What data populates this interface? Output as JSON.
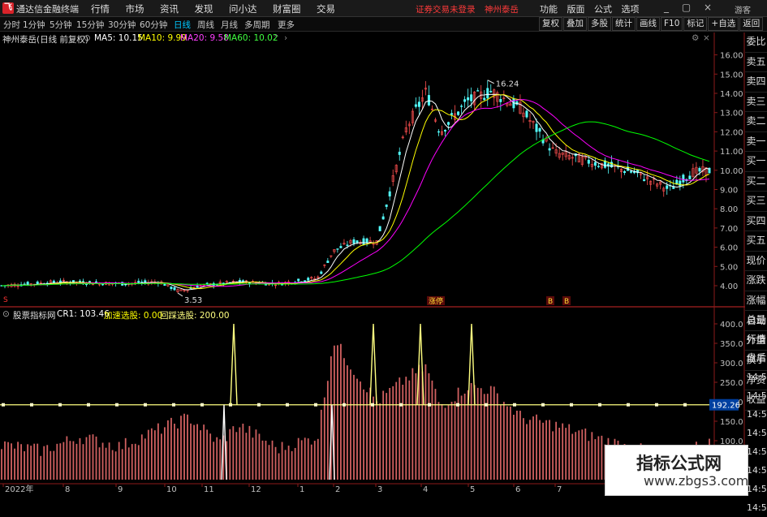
{
  "app": {
    "title": "通达信金融终端"
  },
  "menu": [
    "行情",
    "市场",
    "资讯",
    "发现",
    "问小达",
    "财富圈",
    "交易"
  ],
  "notice": {
    "line1": "证券交易未登录",
    "line2": "神州泰岳"
  },
  "right_menu": [
    "功能",
    "版面",
    "公式",
    "选项"
  ],
  "window_controls": "_ ▢ ×",
  "guest_label": "游客",
  "periods": [
    "分时",
    "1分钟",
    "5分钟",
    "15分钟",
    "30分钟",
    "60分钟",
    "日线",
    "周线",
    "月线",
    "多周期",
    "更多"
  ],
  "active_period": "日线",
  "right_tools": [
    "复权",
    "叠加",
    "多股",
    "统计",
    "画线",
    "F10",
    "标记",
    "+自选",
    "返回"
  ],
  "price_header": {
    "name": "神州泰岳(日线 前复权)",
    "ma5": "MA5: 10.15",
    "ma10": "MA10: 9.99",
    "ma20": "MA20: 9.58",
    "ma60": "MA60: 10.02"
  },
  "indicator_header": {
    "name": "股票指标网",
    "cr1": "CR1: 103.46",
    "jiasu": "加速选股: 0.00",
    "huixuan": "回踩选股: 200.00"
  },
  "price_axis": [
    "16.00",
    "15.00",
    "14.00",
    "13.00",
    "12.00",
    "11.00",
    "10.00",
    "9.00",
    "8.00",
    "7.00",
    "6.00",
    "5.00",
    "4.00"
  ],
  "price_marks": {
    "high": "16.24",
    "low": "3.53"
  },
  "event_labels": [
    "涨停",
    "B",
    "B"
  ],
  "indicator_axis": [
    "400.0",
    "350.0",
    "300.0",
    "250.0",
    "200.0",
    "150.0",
    "100.0",
    "50.00"
  ],
  "indicator_value_tag": "192.26",
  "time_axis": [
    "2022年",
    "8",
    "9",
    "10",
    "11",
    "12",
    "1",
    "2",
    "3",
    "4",
    "5",
    "6",
    "7"
  ],
  "right_panel": [
    "委比",
    "卖五",
    "卖四",
    "卖三",
    "卖二",
    "卖一",
    "买一",
    "买二",
    "买三",
    "买四",
    "买五",
    "现价",
    "涨跌",
    "涨幅",
    "总量",
    "外盘",
    "换手",
    "净资",
    "收益"
  ],
  "right_panel2": [
    "自动",
    "行情",
    "盘后",
    "14:50",
    "14:50",
    "14:50",
    "14:50",
    "14:50",
    "14:50",
    "14:50",
    "14:50"
  ],
  "watermark": {
    "title": "指标公式网",
    "url": "www.zbgs3.com"
  },
  "colors": {
    "ma5": "#ffffff",
    "ma10": "#ffff00",
    "ma20": "#ff00ff",
    "ma60": "#00ff00",
    "candle_down": "#54ffff",
    "candle_up": "#ff5050",
    "cr_bar": "#d06060",
    "signal_line": "#ffff80"
  },
  "chart_data": {
    "type": "line",
    "title": "神州泰岳(日线 前复权)",
    "x": [
      "2022年",
      "8",
      "9",
      "10",
      "11",
      "12",
      "1",
      "2",
      "3",
      "4",
      "5",
      "6",
      "7"
    ],
    "series": [
      {
        "name": "MA60",
        "values": [
          4.0,
          4.1,
          4.2,
          4.2,
          4.2,
          4.2,
          4.3,
          4.9,
          6.5,
          9.0,
          11.3,
          12.5,
          10.8
        ]
      },
      {
        "name": "MA5",
        "values": [
          4.0,
          4.1,
          4.2,
          3.9,
          4.3,
          4.1,
          4.2,
          5.8,
          6.3,
          12.5,
          13.8,
          10.3,
          10.0
        ]
      }
    ],
    "ylim": [
      3.5,
      16.5
    ],
    "annotations": [
      "16.24",
      "3.53"
    ]
  }
}
